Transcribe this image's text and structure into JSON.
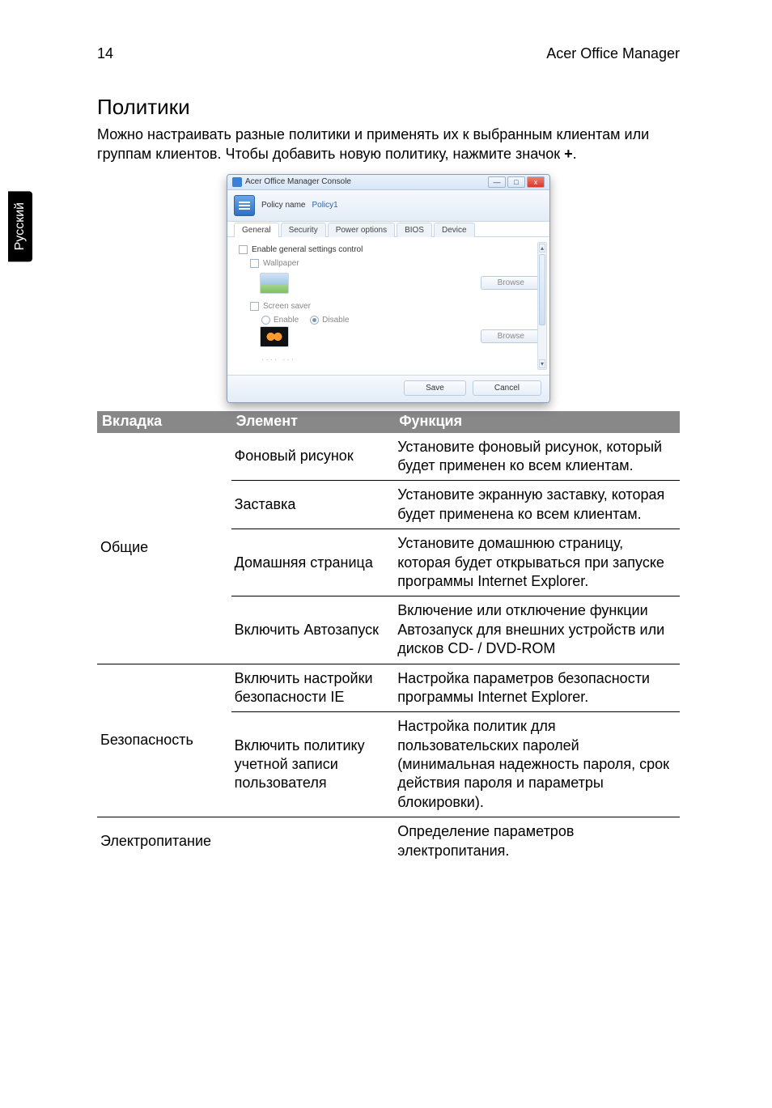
{
  "header": {
    "page_number": "14",
    "doc_title": "Acer Office Manager"
  },
  "side_tab": "Русский",
  "section_title": "Политики",
  "intro_before_bold": "Можно настраивать разные политики и применять их к выбранным клиентам или группам клиентов. Чтобы добавить новую политику, нажмите значок ",
  "intro_bold": "+",
  "intro_after_bold": ".",
  "screenshot": {
    "window_title": "Acer Office Manager Console",
    "win_min": "—",
    "win_max": "□",
    "win_close": "x",
    "policy_name_label": "Policy name",
    "policy_name_value": "Policy1",
    "tabs": {
      "general": "General",
      "security": "Security",
      "power": "Power options",
      "bios": "BIOS",
      "device": "Device"
    },
    "enable_general": "Enable general settings control",
    "wallpaper_label": "Wallpaper",
    "browse_label": "Browse",
    "screen_saver_label": "Screen saver",
    "enable_label": "Enable",
    "disable_label": "Disable",
    "faded": "···· ···",
    "save": "Save",
    "cancel": "Cancel",
    "scroll_up": "▴",
    "scroll_down": "▾"
  },
  "table": {
    "head": {
      "tab": "Вкладка",
      "element": "Элемент",
      "function": "Функция"
    },
    "groups": [
      {
        "tab_label": "Общие",
        "rows": [
          {
            "element": "Фоновый рисунок",
            "function": "Установите фоновый рисунок, который будет применен ко всем клиентам."
          },
          {
            "element": "Заставка",
            "function": "Установите экранную заставку, которая будет применена ко всем клиентам."
          },
          {
            "element": "Домашняя страница",
            "function": "Установите домашнюю страницу, которая будет открываться при запуске программы Internet Explorer."
          },
          {
            "element": "Включить Автозапуск",
            "function": "Включение или отключение функции Автозапуск для внешних устройств или дисков CD- / DVD-ROM"
          }
        ]
      },
      {
        "tab_label": "Безопасность",
        "rows": [
          {
            "element": "Включить настройки безопасности IE",
            "function": "Настройка параметров безопасности программы Internet Explorer."
          },
          {
            "element": "Включить политику учетной записи пользователя",
            "function": "Настройка политик для пользовательских паролей (минимальная надежность пароля, срок действия пароля и параметры блокировки)."
          }
        ]
      },
      {
        "tab_label": "Электропитание",
        "rows": [
          {
            "element": "",
            "function": "Определение параметров электропитания."
          }
        ]
      }
    ]
  }
}
